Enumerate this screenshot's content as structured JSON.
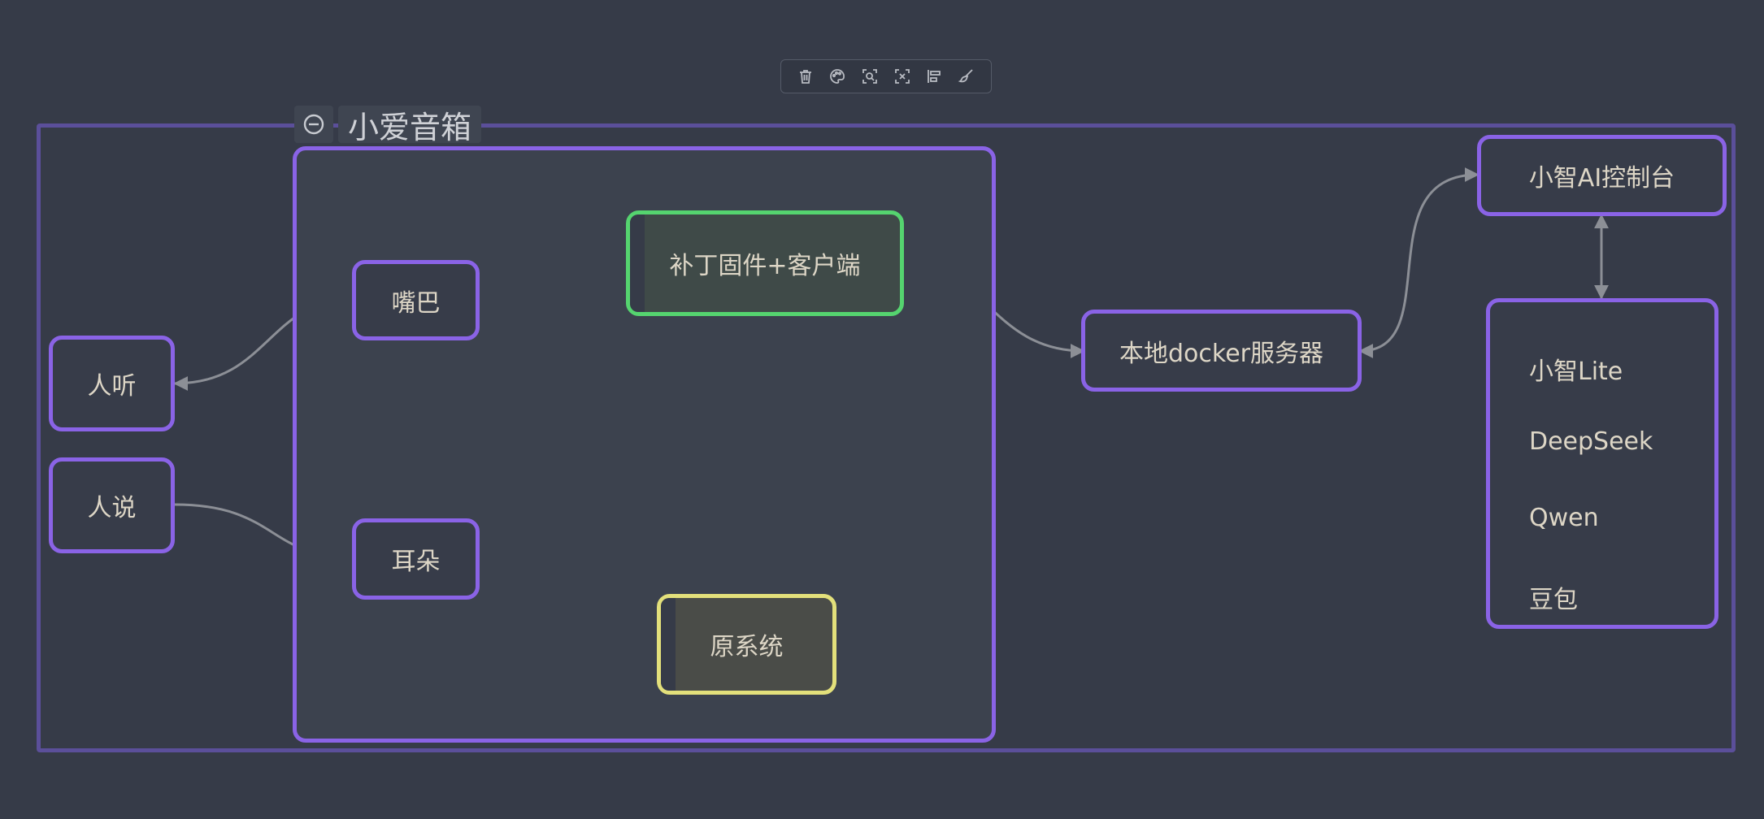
{
  "toolbar": {
    "icons": [
      "trash-icon",
      "palette-icon",
      "zoom-fit-icon",
      "focus-icon",
      "align-icon",
      "brush-icon"
    ]
  },
  "group": {
    "title": "小爱音箱"
  },
  "nodes": {
    "mouth": "嘴巴",
    "patch": "补丁固件+客户端",
    "human_hear": "人听",
    "human_say": "人说",
    "ear": "耳朵",
    "original": "原系统",
    "docker": "本地docker服务器",
    "console": "小智AI控制台"
  },
  "models": [
    "小智Lite",
    "DeepSeek",
    "Qwen",
    "豆包"
  ],
  "colors": {
    "background": "#363b48",
    "node_border": "#8a63e6",
    "patch_border": "#55d46f",
    "original_border": "#e3e07b",
    "edge": "#8c8f96"
  }
}
